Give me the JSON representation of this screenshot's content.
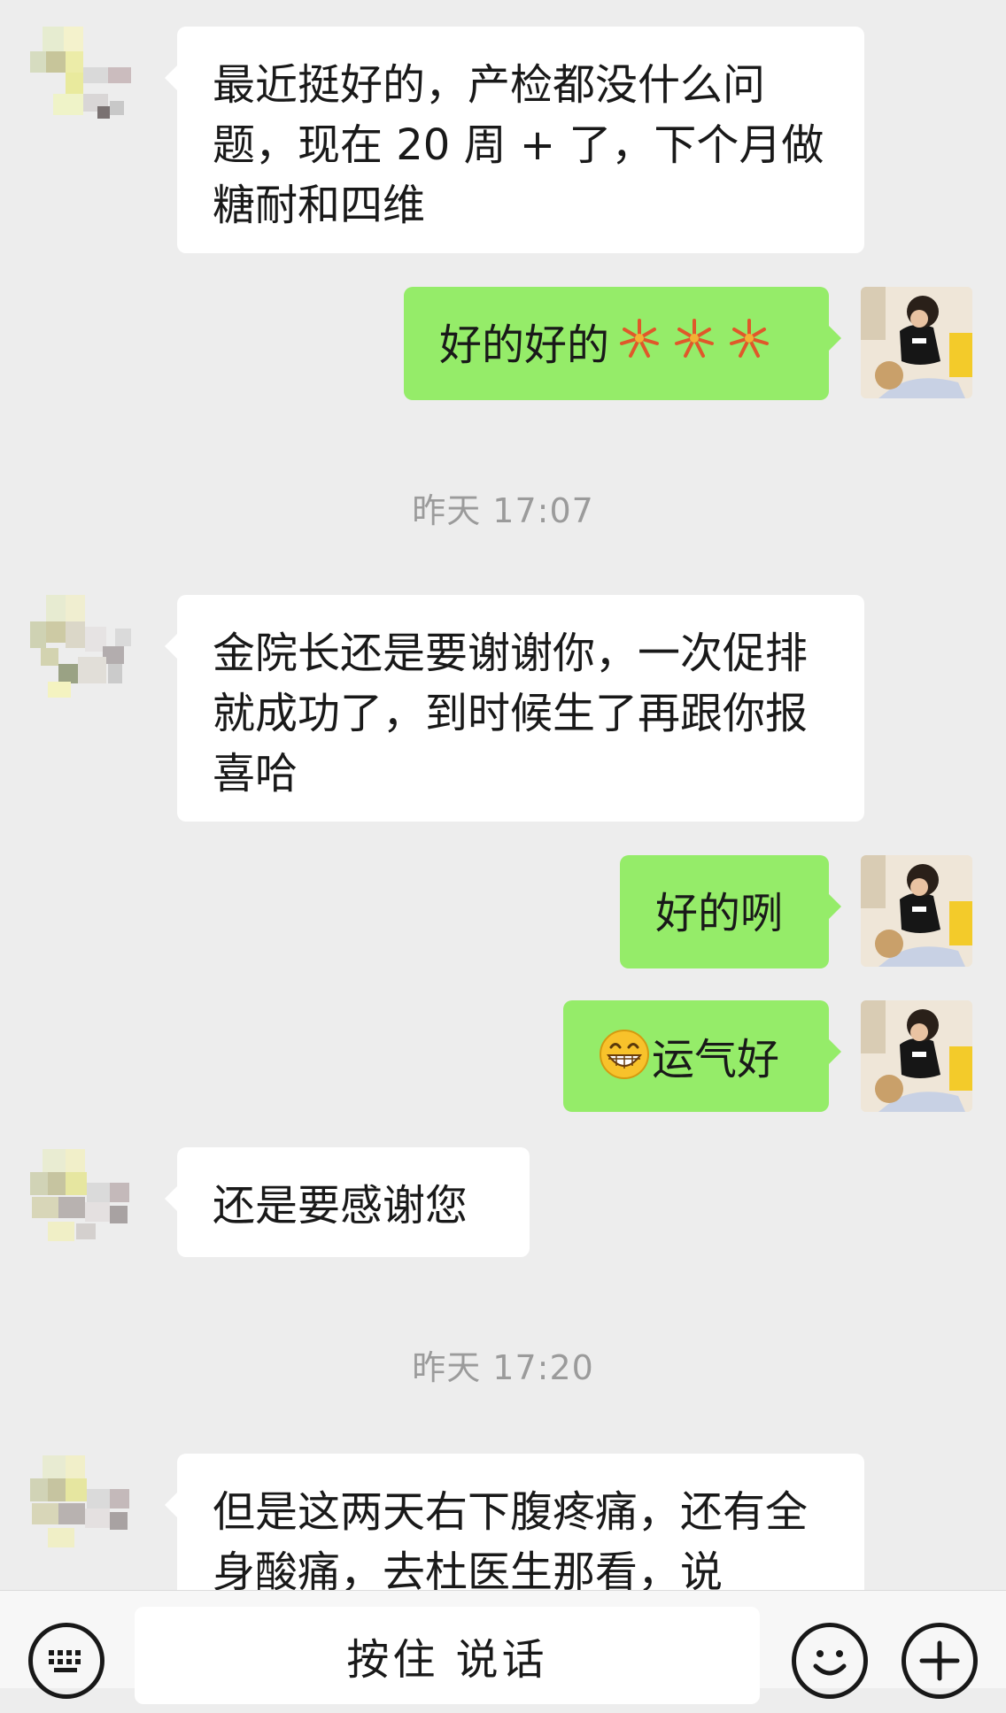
{
  "messages": [
    {
      "side": "left",
      "text": "最近挺好的，产检都没什么问题，现在 20 周 + 了，下个月做糖耐和四维"
    },
    {
      "side": "right",
      "text": "好的好的",
      "emoji": "fireworks"
    },
    {
      "type": "time",
      "text": "昨天 17:07"
    },
    {
      "side": "left",
      "text": "金院长还是要谢谢你，一次促排就成功了，到时候生了再跟你报喜哈"
    },
    {
      "side": "right",
      "text": "好的咧"
    },
    {
      "side": "right",
      "text": "运气好",
      "emoji": "grin"
    },
    {
      "side": "left",
      "text": "还是要感谢您"
    },
    {
      "type": "time",
      "text": "昨天 17:20"
    },
    {
      "side": "left",
      "text": "但是这两天右下腹疼痛，还有全身酸痛，去杜医生那看，说"
    }
  ],
  "input": {
    "voice_label": "按住 说话"
  },
  "icons": {
    "keyboard": "keyboard-icon",
    "emoji": "emoji-icon",
    "plus": "plus-icon",
    "fireworks": "fireworks-icon",
    "grin": "grin-emoji-icon"
  },
  "colors": {
    "background": "#ededed",
    "bubble_left": "#ffffff",
    "bubble_right": "#95ec69",
    "timestamp": "#9b9b9b"
  }
}
